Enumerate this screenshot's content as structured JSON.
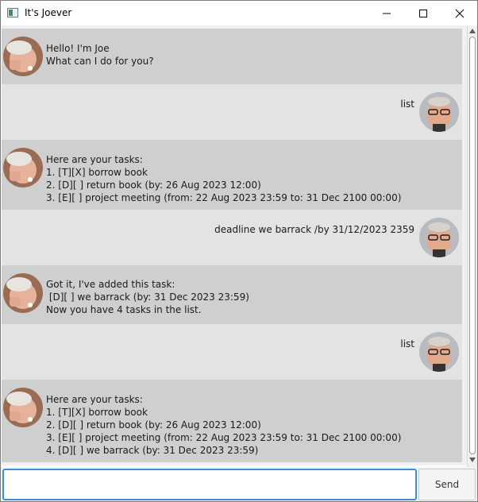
{
  "window": {
    "title": "It's Joever"
  },
  "colors": {
    "bot_bubble": "#cfcfcf",
    "user_bubble": "#e3e3e3",
    "input_focus": "#3b8fd8"
  },
  "messages": [
    {
      "sender": "bot",
      "avatar": "joe-avatar",
      "text": "Hello! I'm Joe\nWhat can I do for you?"
    },
    {
      "sender": "user",
      "avatar": "user-avatar",
      "text": "list"
    },
    {
      "sender": "bot",
      "avatar": "joe-avatar",
      "text": "Here are your tasks:\n1. [T][X] borrow book\n2. [D][ ] return book (by: 26 Aug 2023 12:00)\n3. [E][ ] project meeting (from: 22 Aug 2023 23:59 to: 31 Dec 2100 00:00)"
    },
    {
      "sender": "user",
      "avatar": "user-avatar",
      "text": "deadline we barrack /by 31/12/2023 2359"
    },
    {
      "sender": "bot",
      "avatar": "joe-avatar",
      "text": "Got it, I've added this task:\n [D][ ] we barrack (by: 31 Dec 2023 23:59)\nNow you have 4 tasks in the list."
    },
    {
      "sender": "user",
      "avatar": "user-avatar",
      "text": "list"
    },
    {
      "sender": "bot",
      "avatar": "joe-avatar",
      "text": "Here are your tasks:\n1. [T][X] borrow book\n2. [D][ ] return book (by: 26 Aug 2023 12:00)\n3. [E][ ] project meeting (from: 22 Aug 2023 23:59 to: 31 Dec 2100 00:00)\n4. [D][ ] we barrack (by: 31 Dec 2023 23:59)"
    }
  ],
  "input": {
    "value": "",
    "placeholder": ""
  },
  "send_button": {
    "label": "Send"
  }
}
